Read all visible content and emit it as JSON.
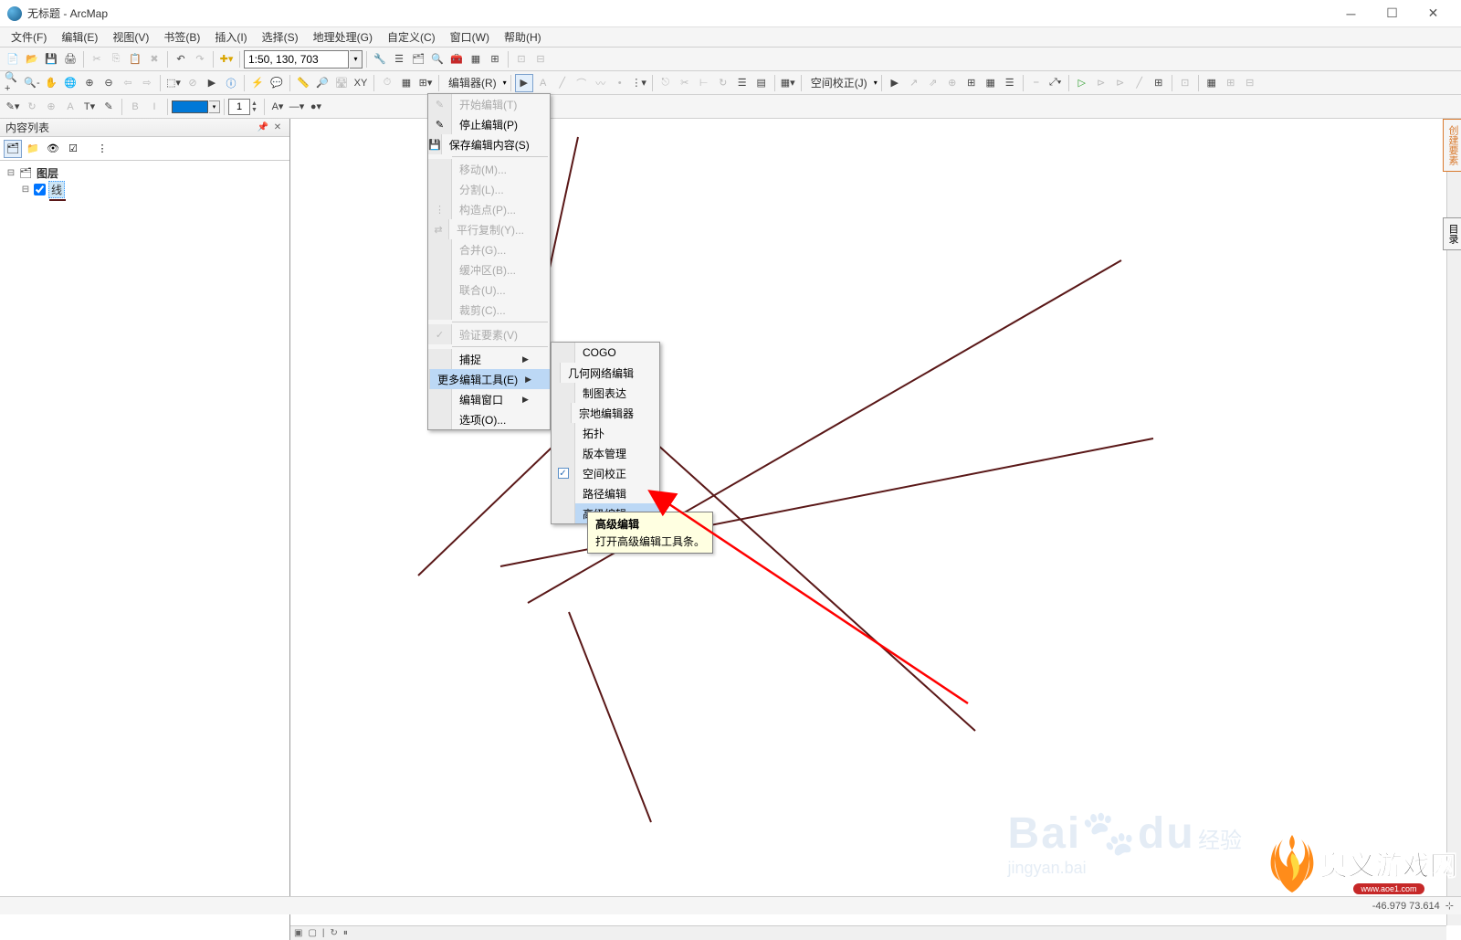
{
  "window": {
    "title": "无标题 - ArcMap"
  },
  "menubar": [
    "文件(F)",
    "编辑(E)",
    "视图(V)",
    "书签(B)",
    "插入(I)",
    "选择(S)",
    "地理处理(G)",
    "自定义(C)",
    "窗口(W)",
    "帮助(H)"
  ],
  "scale": {
    "value": "1:50, 130, 703"
  },
  "toolbar3": {
    "editor_label": "编辑器(R)",
    "spatial_adj_label": "空间校正(J)"
  },
  "draw_width": "1",
  "toc": {
    "title": "内容列表",
    "root": "图层",
    "layer": "线"
  },
  "editor_menu": {
    "items": [
      {
        "label": "开始编辑(T)",
        "disabled": true,
        "icon": "✎"
      },
      {
        "label": "停止编辑(P)",
        "icon": "✎"
      },
      {
        "label": "保存编辑内容(S)",
        "icon": "💾"
      },
      {
        "sep": true
      },
      {
        "label": "移动(M)...",
        "disabled": true
      },
      {
        "label": "分割(L)...",
        "disabled": true
      },
      {
        "label": "构造点(P)...",
        "disabled": true,
        "icon": "⋮"
      },
      {
        "label": "平行复制(Y)...",
        "disabled": true,
        "icon": "⇄"
      },
      {
        "label": "合并(G)...",
        "disabled": true
      },
      {
        "label": "缓冲区(B)...",
        "disabled": true
      },
      {
        "label": "联合(U)...",
        "disabled": true
      },
      {
        "label": "裁剪(C)...",
        "disabled": true
      },
      {
        "sep": true
      },
      {
        "label": "验证要素(V)",
        "disabled": true,
        "icon": "✓"
      },
      {
        "sep": true
      },
      {
        "label": "捕捉",
        "arrow": true
      },
      {
        "label": "更多编辑工具(E)",
        "arrow": true,
        "highlighted": true
      },
      {
        "label": "编辑窗口",
        "arrow": true
      },
      {
        "label": "选项(O)..."
      }
    ]
  },
  "submenu": {
    "items": [
      {
        "label": "COGO"
      },
      {
        "label": "几何网络编辑"
      },
      {
        "label": "制图表达"
      },
      {
        "label": "宗地编辑器"
      },
      {
        "label": "拓扑"
      },
      {
        "label": "版本管理"
      },
      {
        "label": "空间校正",
        "checked": true
      },
      {
        "label": "路径编辑"
      },
      {
        "label": "高级编辑",
        "highlighted": true
      }
    ]
  },
  "tooltip": {
    "title": "高级编辑",
    "desc": "打开高级编辑工具条。"
  },
  "side_tabs": {
    "tab1": "创建要素",
    "tab2": "目录"
  },
  "status": {
    "coords": "-46.979  73.614"
  },
  "watermark": {
    "text1": "Bai",
    "text2": "du",
    "sub": "经验",
    "url": "jingyan.bai"
  },
  "brand": {
    "name": "奥义游戏网",
    "url": "www.aoe1.com"
  }
}
